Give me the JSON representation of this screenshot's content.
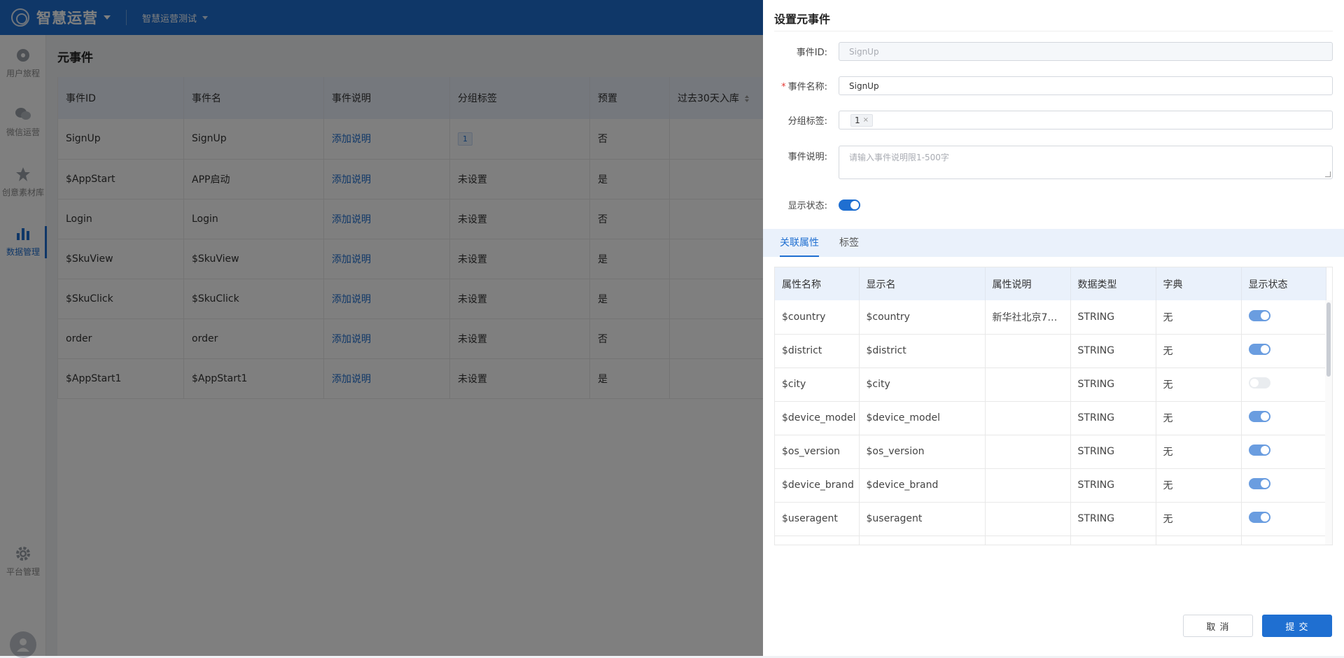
{
  "topbar": {
    "app_name": "智慧运营",
    "project": "智慧运营测试"
  },
  "sidebar": {
    "items": [
      {
        "label": "用户旅程",
        "icon": "journey-icon"
      },
      {
        "label": "微信运营",
        "icon": "wechat-icon"
      },
      {
        "label": "创意素材库",
        "icon": "material-icon"
      },
      {
        "label": "数据管理",
        "icon": "bar-chart-icon",
        "active": true
      },
      {
        "label": "平台管理",
        "icon": "gear-icon"
      }
    ]
  },
  "main": {
    "title": "元事件",
    "columns": [
      "事件ID",
      "事件名",
      "事件说明",
      "分组标签",
      "预置",
      "过去30天入库"
    ],
    "rows": [
      {
        "id": "SignUp",
        "name": "SignUp",
        "desc": "添加说明",
        "group": "1",
        "group_is_tag": true,
        "preset": "否"
      },
      {
        "id": "$AppStart",
        "name": "APP启动",
        "desc": "添加说明",
        "group": "未设置",
        "preset": "是"
      },
      {
        "id": "Login",
        "name": "Login",
        "desc": "添加说明",
        "group": "未设置",
        "preset": "否"
      },
      {
        "id": "$SkuView",
        "name": "$SkuView",
        "desc": "添加说明",
        "group": "未设置",
        "preset": "是"
      },
      {
        "id": "$SkuClick",
        "name": "$SkuClick",
        "desc": "添加说明",
        "group": "未设置",
        "preset": "是"
      },
      {
        "id": "order",
        "name": "order",
        "desc": "添加说明",
        "group": "未设置",
        "preset": "否"
      },
      {
        "id": "$AppStart1",
        "name": "$AppStart1",
        "desc": "添加说明",
        "group": "未设置",
        "preset": "是"
      }
    ]
  },
  "drawer": {
    "title": "设置元事件",
    "fields": {
      "event_id_label": "事件ID:",
      "event_id_value": "SignUp",
      "event_name_label": "事件名称:",
      "event_name_value": "SignUp",
      "group_label": "分组标签:",
      "group_tag": "1",
      "desc_label": "事件说明:",
      "desc_placeholder": "请输入事件说明限1-500字",
      "status_label": "显示状态:",
      "status_on": true
    },
    "tabs": [
      {
        "label": "关联属性",
        "active": true
      },
      {
        "label": "标签",
        "active": false
      }
    ],
    "prop_columns": [
      "属性名称",
      "显示名",
      "属性说明",
      "数据类型",
      "字典",
      "显示状态"
    ],
    "props": [
      {
        "name": "$country",
        "display": "$country",
        "desc": "新华社北京7…",
        "type": "STRING",
        "dict": "无",
        "on": true
      },
      {
        "name": "$district",
        "display": "$district",
        "desc": "",
        "type": "STRING",
        "dict": "无",
        "on": true
      },
      {
        "name": "$city",
        "display": "$city",
        "desc": "",
        "type": "STRING",
        "dict": "无",
        "on": false
      },
      {
        "name": "$device_model",
        "display": "$device_model",
        "desc": "",
        "type": "STRING",
        "dict": "无",
        "on": true
      },
      {
        "name": "$os_version",
        "display": "$os_version",
        "desc": "",
        "type": "STRING",
        "dict": "无",
        "on": true
      },
      {
        "name": "$device_brand",
        "display": "$device_brand",
        "desc": "",
        "type": "STRING",
        "dict": "无",
        "on": true
      },
      {
        "name": "$useragent",
        "display": "$useragent",
        "desc": "",
        "type": "STRING",
        "dict": "无",
        "on": true
      }
    ],
    "buttons": {
      "cancel": "取 消",
      "submit": "提 交"
    }
  },
  "colors": {
    "primary": "#1f6fd1",
    "header_bg": "#eaf1fb",
    "overlay": "rgba(0,0,0,0.5)"
  }
}
